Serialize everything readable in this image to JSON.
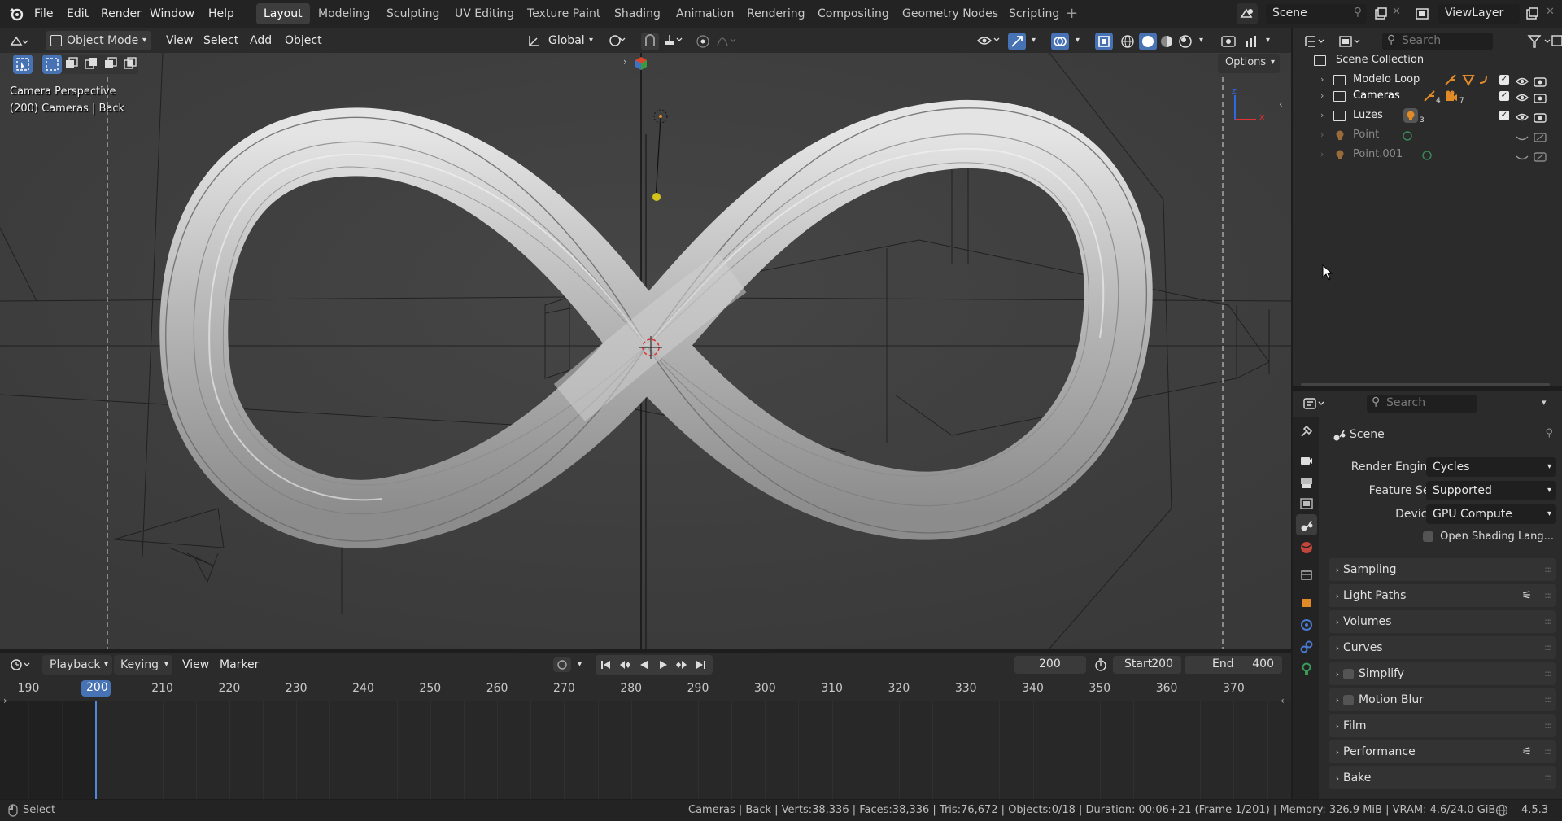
{
  "topbar": {
    "menus": [
      "File",
      "Edit",
      "Render",
      "Window",
      "Help"
    ],
    "workspaces": [
      {
        "label": "Layout",
        "active": true
      },
      {
        "label": "Modeling"
      },
      {
        "label": "Sculpting"
      },
      {
        "label": "UV Editing"
      },
      {
        "label": "Texture Paint"
      },
      {
        "label": "Shading"
      },
      {
        "label": "Animation"
      },
      {
        "label": "Rendering"
      },
      {
        "label": "Compositing"
      },
      {
        "label": "Geometry Nodes"
      },
      {
        "label": "Scripting"
      }
    ],
    "scene_name": "Scene",
    "view_layer": "ViewLayer"
  },
  "viewport_header": {
    "mode": "Object Mode",
    "menus": [
      "View",
      "Select",
      "Add",
      "Object"
    ],
    "transform_orientation": "Global",
    "options_label": "Options"
  },
  "viewport": {
    "overlay_line1": "Camera Perspective",
    "overlay_line2": "(200) Cameras | Back",
    "axis_z": "z",
    "axis_x": "x"
  },
  "timeline": {
    "menus": [
      "Playback",
      "Keying",
      "View",
      "Marker"
    ],
    "current_frame": "200",
    "start_label": "Start",
    "start_value": "200",
    "end_label": "End",
    "end_value": "400",
    "frame_labels": [
      "190",
      "200",
      "210",
      "220",
      "230",
      "240",
      "250",
      "260",
      "270",
      "280",
      "290",
      "300",
      "310",
      "320",
      "330",
      "340",
      "350",
      "360",
      "370"
    ]
  },
  "outliner": {
    "search_placeholder": "Search",
    "root": "Scene Collection",
    "items": [
      {
        "label": "Modelo Loop",
        "dim": false
      },
      {
        "label": "Cameras",
        "dim": false
      },
      {
        "label": "Luzes",
        "dim": false
      },
      {
        "label": "Point",
        "dim": true
      },
      {
        "label": "Point.001",
        "dim": true
      }
    ],
    "badge_cameras_1": "4",
    "badge_cameras_2": "7",
    "badge_luzes": "3"
  },
  "properties": {
    "search_placeholder": "Search",
    "context": "Scene",
    "render_engine_label": "Render Engine",
    "render_engine_value": "Cycles",
    "feature_set_label": "Feature Set",
    "feature_set_value": "Supported",
    "device_label": "Device",
    "device_value": "GPU Compute",
    "osl_label": "Open Shading Lang...",
    "panels": [
      "Sampling",
      "Light Paths",
      "Volumes",
      "Curves",
      "Simplify",
      "Motion Blur",
      "Film",
      "Performance",
      "Bake"
    ]
  },
  "statusbar": {
    "left_hint": "Select",
    "stats": "Cameras | Back | Verts:38,336 | Faces:38,336 | Tris:76,672 | Objects:0/18 | Duration: 00:06+21 (Frame 1/201) | Memory: 326.9 MiB | VRAM: 4.6/24.0 GiB",
    "version": "4.5.3"
  },
  "colors": {
    "accent_blue": "#4772b3",
    "active_tab": "#3d3d3d",
    "playhead": "#4a8ad8",
    "light_yellow": "#d4c41a",
    "object_orange": "#e08a28"
  }
}
